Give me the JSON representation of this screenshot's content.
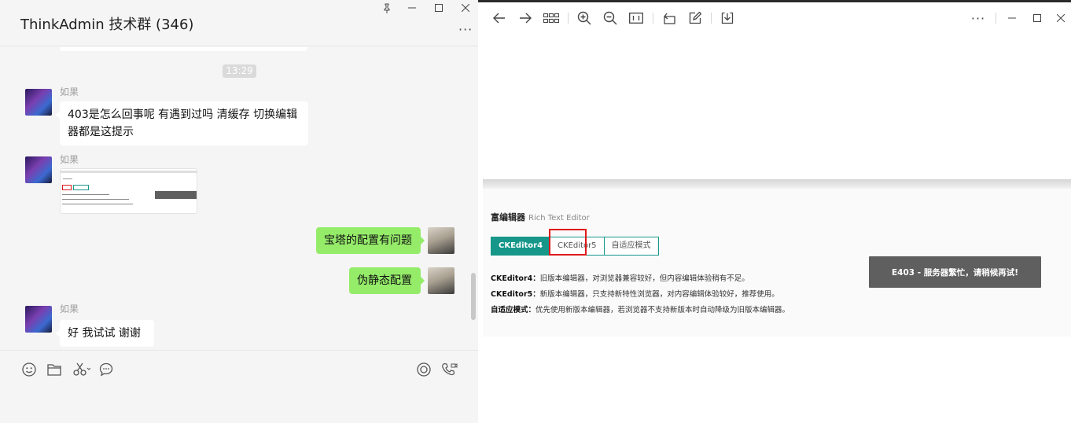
{
  "chat": {
    "title": "ThinkAdmin 技术群 (346)",
    "more_label": "···",
    "time_chip": "13:29",
    "messages": [
      {
        "sender": "如果",
        "text_line1": "403是怎么回事呢  有遇到过吗  清缓存 切换编辑",
        "text_line2": "器都是这提示"
      },
      {
        "sender": "如果"
      },
      {
        "text": "宝塔的配置有问题"
      },
      {
        "text": "伪静态配置"
      },
      {
        "sender": "如果",
        "text": "好  我试试  谢谢"
      }
    ]
  },
  "icons": {
    "pin": "pin-icon",
    "minimize": "minimize-icon",
    "maximize": "maximize-icon",
    "close": "close-icon",
    "emoji": "emoji-icon",
    "folder": "folder-icon",
    "scissors": "scissors-icon",
    "chat": "chat-bubble-icon",
    "live": "live-icon",
    "video-call": "video-call-icon"
  },
  "editor_screenshot": {
    "heading": "富编辑器",
    "heading_en": "Rich Text Editor",
    "tabs": [
      "CKEditor4",
      "CKEditor5",
      "自适应模式"
    ],
    "desc": [
      {
        "label": "CKEditor4：",
        "text": "旧版本编辑器，对浏览器兼容较好，但内容编辑体验稍有不足。"
      },
      {
        "label": "CKEditor5：",
        "text": "新版本编辑器，只支持新特性浏览器，对内容编辑体验较好，推荐使用。"
      },
      {
        "label": "自适应模式：",
        "text": "优先使用新版本编辑器，若浏览器不支持新版本时自动降级为旧版本编辑器。"
      }
    ],
    "toast": "E403 - 服务器繁忙，请稍候再试!"
  },
  "viewer": {
    "more_label": "···"
  },
  "colors": {
    "accent": "#16978a",
    "bubble_out": "#95ec69",
    "highlight": "#e0191b"
  }
}
